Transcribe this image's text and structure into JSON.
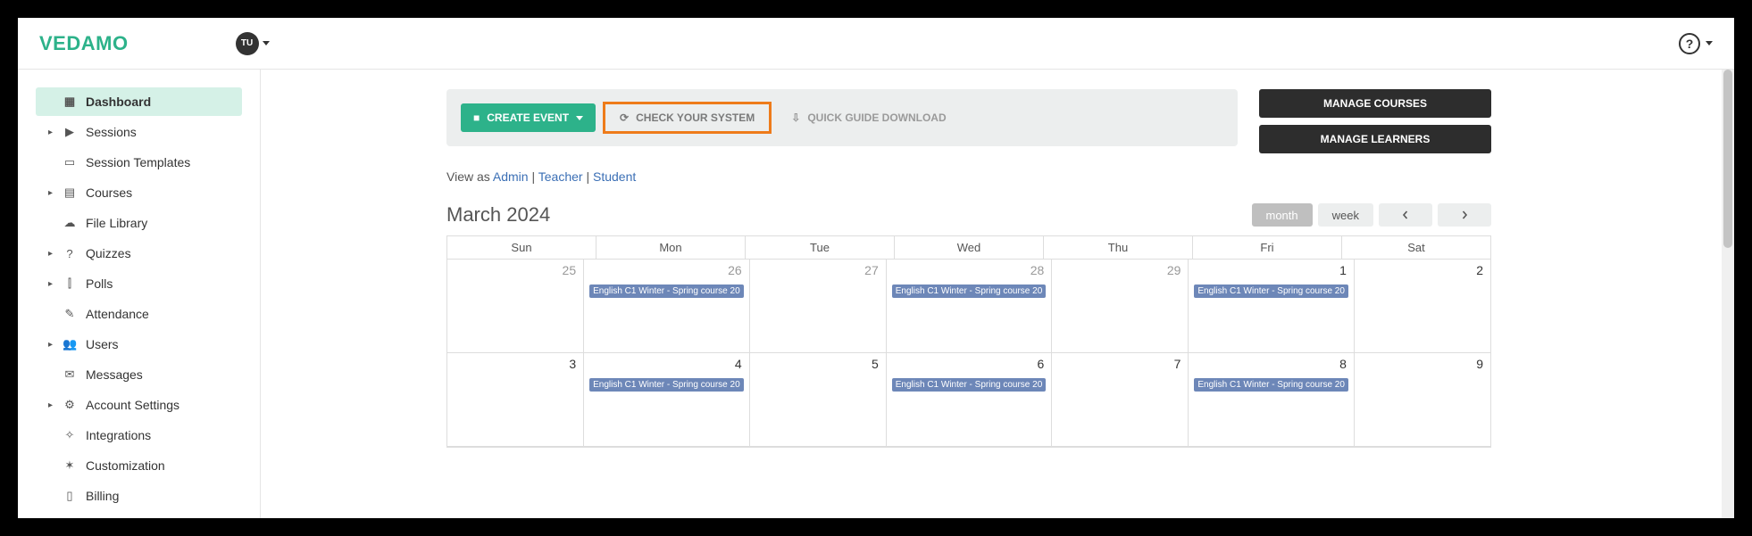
{
  "brand": "VEDAMO",
  "avatar_initials": "TU",
  "sidebar": {
    "items": [
      {
        "label": "Dashboard",
        "icon": "▦",
        "expandable": false,
        "active": true
      },
      {
        "label": "Sessions",
        "icon": "▶",
        "expandable": true,
        "active": false
      },
      {
        "label": "Session Templates",
        "icon": "▭",
        "expandable": false,
        "active": false
      },
      {
        "label": "Courses",
        "icon": "▤",
        "expandable": true,
        "active": false
      },
      {
        "label": "File Library",
        "icon": "☁",
        "expandable": false,
        "active": false
      },
      {
        "label": "Quizzes",
        "icon": "?",
        "expandable": true,
        "active": false
      },
      {
        "label": "Polls",
        "icon": "⫿",
        "expandable": true,
        "active": false
      },
      {
        "label": "Attendance",
        "icon": "✎",
        "expandable": false,
        "active": false
      },
      {
        "label": "Users",
        "icon": "👥",
        "expandable": true,
        "active": false
      },
      {
        "label": "Messages",
        "icon": "✉",
        "expandable": false,
        "active": false
      },
      {
        "label": "Account Settings",
        "icon": "⚙",
        "expandable": true,
        "active": false
      },
      {
        "label": "Integrations",
        "icon": "✧",
        "expandable": false,
        "active": false
      },
      {
        "label": "Customization",
        "icon": "✶",
        "expandable": false,
        "active": false
      },
      {
        "label": "Billing",
        "icon": "▯",
        "expandable": false,
        "active": false
      }
    ]
  },
  "actions": {
    "create_event": "CREATE EVENT",
    "check_system": "CHECK YOUR SYSTEM",
    "quick_guide": "QUICK GUIDE DOWNLOAD",
    "manage_courses": "MANAGE COURSES",
    "manage_learners": "MANAGE LEARNERS"
  },
  "view_as": {
    "prefix": "View as ",
    "admin": "Admin",
    "sep": " | ",
    "teacher": "Teacher",
    "student": "Student"
  },
  "calendar": {
    "title": "March 2024",
    "view_month": "month",
    "view_week": "week",
    "day_headers": [
      "Sun",
      "Mon",
      "Tue",
      "Wed",
      "Thu",
      "Fri",
      "Sat"
    ],
    "event_label": "English C1 Winter - Spring course 20",
    "weeks": [
      {
        "days": [
          {
            "num": "25",
            "muted": true,
            "event": false
          },
          {
            "num": "26",
            "muted": true,
            "event": true
          },
          {
            "num": "27",
            "muted": true,
            "event": false
          },
          {
            "num": "28",
            "muted": true,
            "event": true
          },
          {
            "num": "29",
            "muted": true,
            "event": false
          },
          {
            "num": "1",
            "muted": false,
            "event": true
          },
          {
            "num": "2",
            "muted": false,
            "event": false
          }
        ]
      },
      {
        "days": [
          {
            "num": "3",
            "muted": false,
            "event": false
          },
          {
            "num": "4",
            "muted": false,
            "event": true
          },
          {
            "num": "5",
            "muted": false,
            "event": false
          },
          {
            "num": "6",
            "muted": false,
            "event": true
          },
          {
            "num": "7",
            "muted": false,
            "event": false
          },
          {
            "num": "8",
            "muted": false,
            "event": true
          },
          {
            "num": "9",
            "muted": false,
            "event": false
          }
        ]
      }
    ]
  }
}
